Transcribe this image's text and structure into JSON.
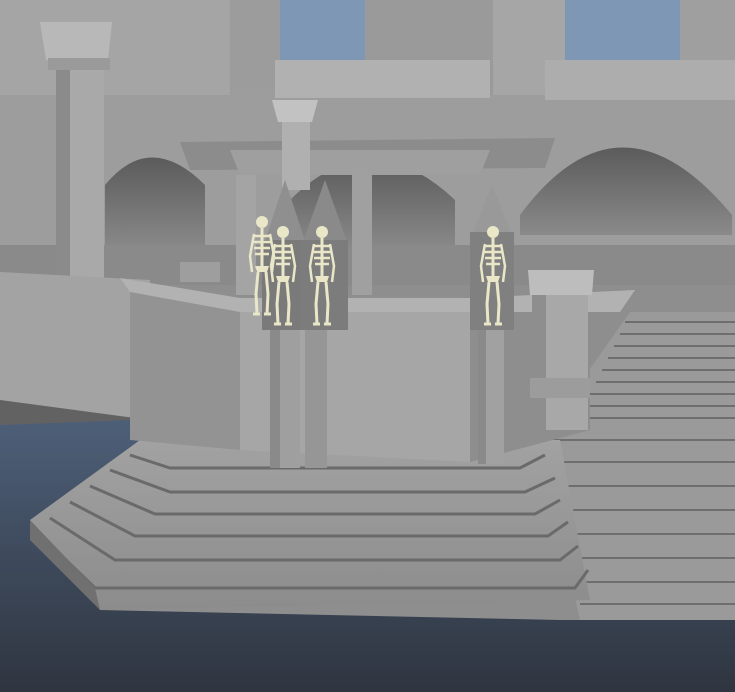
{
  "scene": {
    "description_visible_text": "",
    "palette": {
      "sky": "#7d97b5",
      "wall_light": "#a3a3a3",
      "wall_mid": "#8f8f8f",
      "wall_dark": "#6e6e6e",
      "shadow": "#5a5a5a",
      "water_top": "#4d5f78",
      "water_bottom": "#2f3540",
      "skeleton": "#e9e7c8"
    },
    "skeleton_count": 4
  }
}
